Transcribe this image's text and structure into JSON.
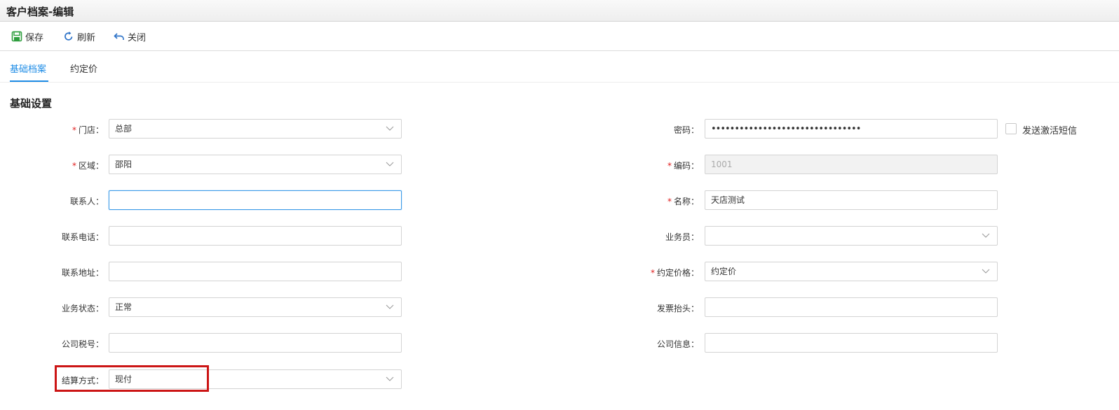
{
  "window": {
    "title": "客户档案-编辑"
  },
  "toolbar": {
    "save_label": "保存",
    "refresh_label": "刷新",
    "close_label": "关闭"
  },
  "tabs": [
    {
      "label": "基础档案",
      "active": true
    },
    {
      "label": "约定价",
      "active": false
    }
  ],
  "section": {
    "title": "基础设置"
  },
  "left_fields": {
    "store": {
      "label": "门店：",
      "required": true,
      "value": "总部",
      "type": "select"
    },
    "region": {
      "label": "区域：",
      "required": true,
      "value": "邵阳",
      "type": "select"
    },
    "contact": {
      "label": "联系人：",
      "required": false,
      "value": "",
      "type": "text"
    },
    "phone": {
      "label": "联系电话：",
      "required": false,
      "value": "",
      "type": "text"
    },
    "address": {
      "label": "联系地址：",
      "required": false,
      "value": "",
      "type": "text"
    },
    "business_status": {
      "label": "业务状态：",
      "required": false,
      "value": "正常",
      "type": "select"
    },
    "tax_no": {
      "label": "公司税号：",
      "required": false,
      "value": "",
      "type": "text"
    },
    "settlement": {
      "label": "结算方式：",
      "required": false,
      "value": "现付",
      "type": "select"
    }
  },
  "right_fields": {
    "password": {
      "label": "密码：",
      "required": false,
      "value": "••••••••••••••••••••••••••••••••",
      "type": "password"
    },
    "code": {
      "label": "编码：",
      "required": true,
      "value": "1001",
      "type": "text",
      "disabled": true
    },
    "name": {
      "label": "名称：",
      "required": true,
      "value": "天店测试",
      "type": "text"
    },
    "salesman": {
      "label": "业务员：",
      "required": false,
      "value": "",
      "type": "select"
    },
    "price_type": {
      "label": "约定价格：",
      "required": true,
      "value": "约定价",
      "type": "select"
    },
    "invoice_title": {
      "label": "发票抬头：",
      "required": false,
      "value": "",
      "type": "text"
    },
    "company_info": {
      "label": "公司信息：",
      "required": false,
      "value": "",
      "type": "text"
    }
  },
  "sms": {
    "label": "发送激活短信",
    "checked": false
  },
  "colors": {
    "accent": "#1e8ce6",
    "required": "#e02020",
    "highlight": "#cc1515",
    "save_icon": "#2e9e3e",
    "refresh_icon": "#2f74c8",
    "close_icon": "#2f74c8"
  },
  "icons": {
    "save": "save-icon",
    "refresh": "refresh-icon",
    "close": "undo-icon",
    "dropdown": "chevron-down-icon"
  }
}
